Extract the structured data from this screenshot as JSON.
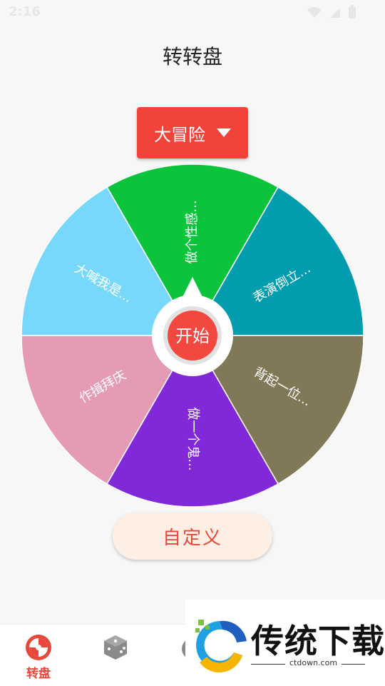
{
  "status_bar": {
    "time": "2:16"
  },
  "header": {
    "title": "转转盘"
  },
  "mode_selector": {
    "label": "大冒险"
  },
  "wheel": {
    "center_label": "开始",
    "segments": [
      {
        "label": "做个性感...",
        "color": "#0bc43b"
      },
      {
        "label": "表演倒立...",
        "color": "#029caf"
      },
      {
        "label": "背起一位...",
        "color": "#817858"
      },
      {
        "label": "做一个鬼...",
        "color": "#8128d8"
      },
      {
        "label": "作揖拜庆",
        "color": "#e59bb5"
      },
      {
        "label": "大喊我是...",
        "color": "#78d8fc"
      }
    ]
  },
  "custom_button": {
    "label": "自定义"
  },
  "tab_bar": {
    "active_color": "#e8473c",
    "tabs": [
      {
        "label": "转盘",
        "icon": "wheel-icon",
        "active": true
      },
      {
        "label": "",
        "icon": "dice-icon",
        "active": false
      },
      {
        "label": "",
        "icon": "game-icon",
        "active": false
      }
    ]
  },
  "watermark": {
    "title": "传统下载",
    "url": "ctdown.com"
  }
}
